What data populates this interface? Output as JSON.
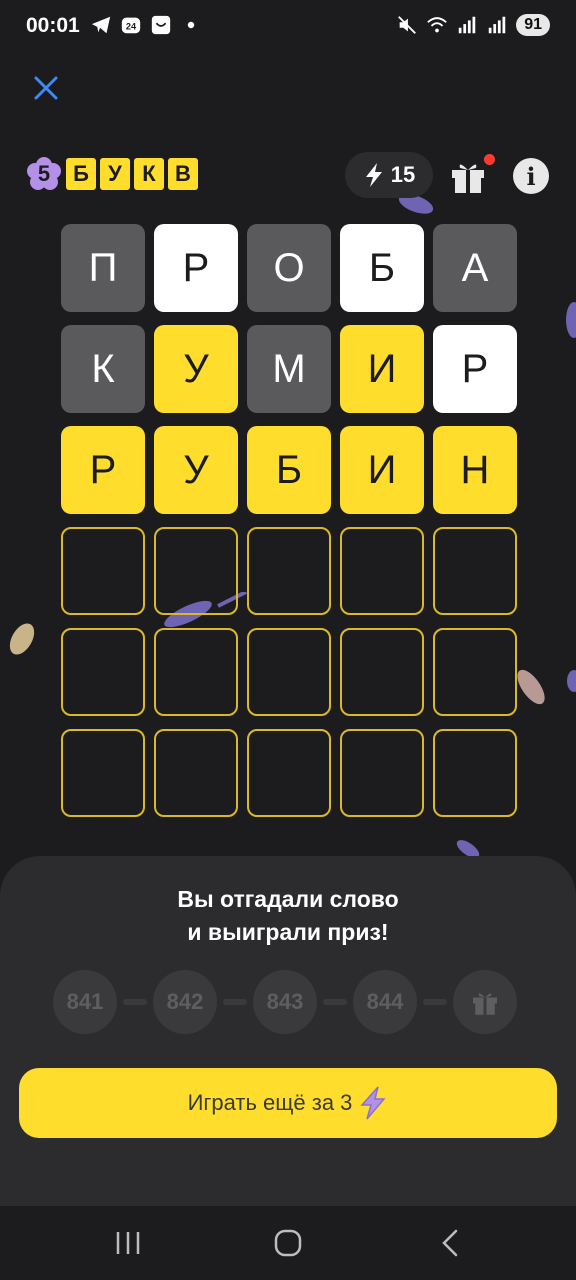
{
  "status_bar": {
    "time": "00:01",
    "battery": "91",
    "app_icons": [
      "telegram-icon",
      "calendar-24-icon",
      "message-icon",
      "dot-icon"
    ],
    "system_icons": [
      "mute-icon",
      "wifi-icon",
      "signal-icon",
      "signal-icon"
    ]
  },
  "header": {
    "logo_number": "5",
    "logo_letters": [
      "Б",
      "У",
      "К",
      "В"
    ],
    "energy_count": "15"
  },
  "board": {
    "rows": [
      [
        {
          "letter": "П",
          "state": "gray"
        },
        {
          "letter": "Р",
          "state": "white"
        },
        {
          "letter": "О",
          "state": "gray"
        },
        {
          "letter": "Б",
          "state": "white"
        },
        {
          "letter": "А",
          "state": "gray"
        }
      ],
      [
        {
          "letter": "К",
          "state": "gray"
        },
        {
          "letter": "У",
          "state": "yellow"
        },
        {
          "letter": "М",
          "state": "gray"
        },
        {
          "letter": "И",
          "state": "yellow"
        },
        {
          "letter": "Р",
          "state": "white"
        }
      ],
      [
        {
          "letter": "Р",
          "state": "yellow"
        },
        {
          "letter": "У",
          "state": "yellow"
        },
        {
          "letter": "Б",
          "state": "yellow"
        },
        {
          "letter": "И",
          "state": "yellow"
        },
        {
          "letter": "Н",
          "state": "yellow"
        }
      ],
      [
        {
          "letter": "",
          "state": "empty"
        },
        {
          "letter": "",
          "state": "empty"
        },
        {
          "letter": "",
          "state": "empty"
        },
        {
          "letter": "",
          "state": "empty"
        },
        {
          "letter": "",
          "state": "empty"
        }
      ],
      [
        {
          "letter": "",
          "state": "empty"
        },
        {
          "letter": "",
          "state": "empty"
        },
        {
          "letter": "",
          "state": "empty"
        },
        {
          "letter": "",
          "state": "empty"
        },
        {
          "letter": "",
          "state": "empty"
        }
      ],
      [
        {
          "letter": "",
          "state": "empty"
        },
        {
          "letter": "",
          "state": "empty"
        },
        {
          "letter": "",
          "state": "empty"
        },
        {
          "letter": "",
          "state": "empty"
        },
        {
          "letter": "",
          "state": "empty"
        }
      ]
    ]
  },
  "result": {
    "line1": "Вы отгадали слово",
    "line2": "и выиграли приз!",
    "steps": [
      "841",
      "842",
      "843",
      "844"
    ]
  },
  "play_button": {
    "label": "Играть ещё за 3"
  },
  "colors": {
    "background": "#1c1c1e",
    "accent_yellow": "#ffdd2d",
    "tile_gray": "#5a5a5c",
    "sheet": "#2c2c2e"
  }
}
